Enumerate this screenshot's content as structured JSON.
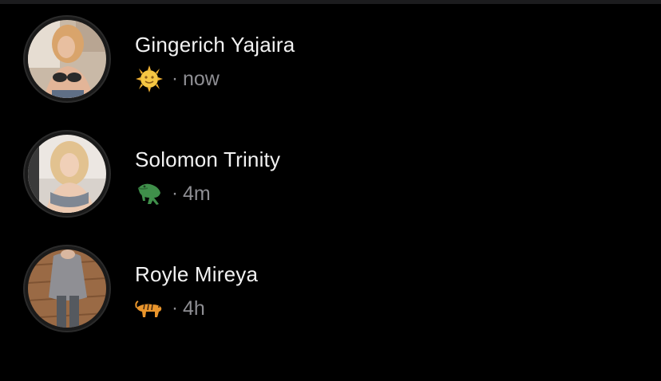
{
  "chats": [
    {
      "name": "Gingerich Yajaira",
      "status_emoji": "sun-with-face-icon",
      "separator": "·",
      "time": "now"
    },
    {
      "name": "Solomon Trinity",
      "status_emoji": "crocodile-icon",
      "separator": "·",
      "time": "4m"
    },
    {
      "name": "Royle Mireya",
      "status_emoji": "tiger-icon",
      "separator": "·",
      "time": "4h"
    }
  ],
  "colors": {
    "background": "#000000",
    "name_text": "#f2f2f2",
    "secondary_text": "#8e8e93",
    "avatar_ring": "#2b2b2b"
  }
}
